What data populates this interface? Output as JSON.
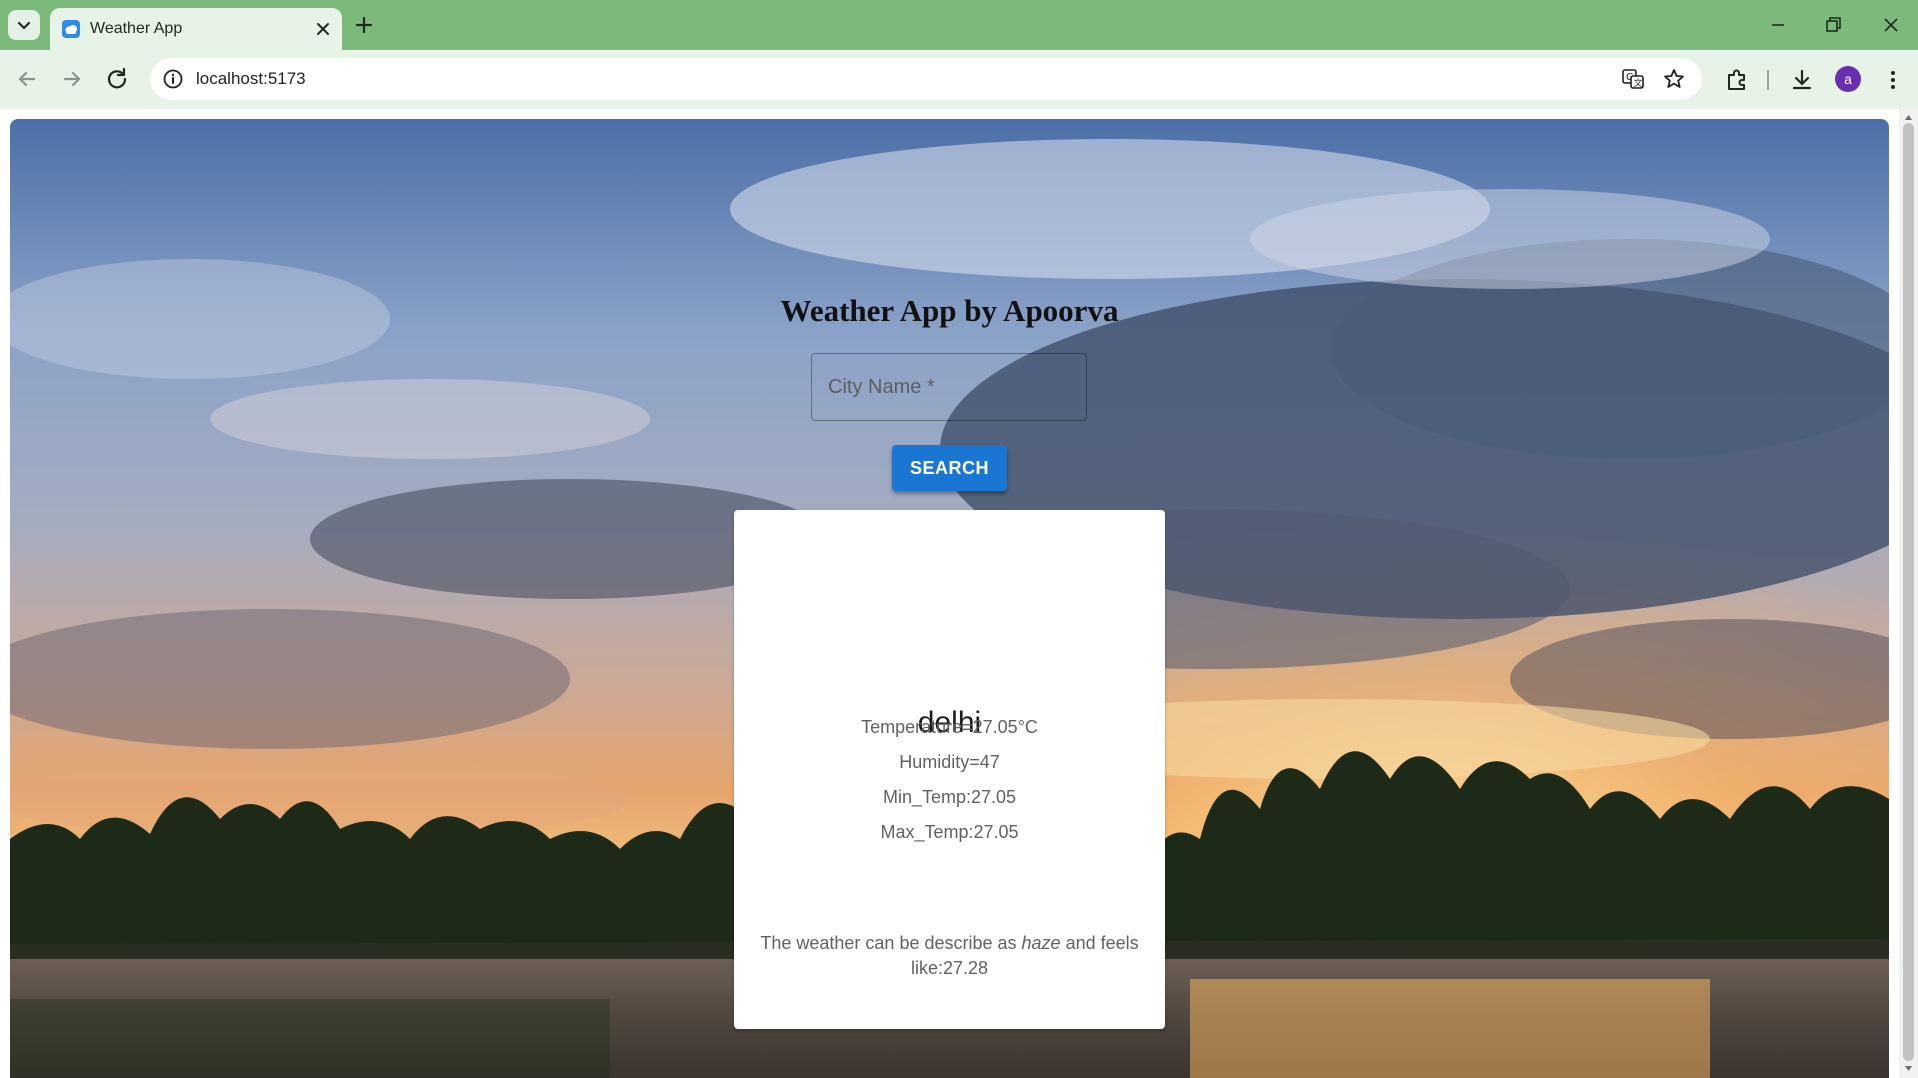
{
  "browser": {
    "tab_title": "Weather App",
    "url": "localhost:5173",
    "profile_initial": "a"
  },
  "icons": {
    "tab_list": "chevron-down-icon",
    "tab_favicon": "cloud-icon",
    "tab_close": "close-icon",
    "new_tab": "plus-icon",
    "back": "arrow-left-icon",
    "forward": "arrow-right-icon",
    "reload": "reload-icon",
    "site_info": "info-icon",
    "translate": "translate-icon",
    "bookmark": "star-icon",
    "extensions": "puzzle-icon",
    "downloads": "download-icon",
    "menu": "kebab-menu-icon"
  },
  "app": {
    "title": "Weather App by Apoorva",
    "search": {
      "placeholder": "City Name *",
      "value": "",
      "button_label": "SEARCH"
    },
    "card": {
      "city": "delhi",
      "temperature": "Temperature=27.05°C",
      "humidity": "Humidity=47",
      "min_temp": "Min_Temp:27.05",
      "max_temp": "Max_Temp:27.05",
      "description_prefix": "The weather can be describe as ",
      "description_condition": "haze",
      "description_suffix": " and feels like:27.28"
    }
  },
  "colors": {
    "tab_strip": "#7cba7c",
    "toolbar": "#e8f3e8",
    "accent_button": "#1976d2",
    "avatar": "#6a2fb0"
  }
}
